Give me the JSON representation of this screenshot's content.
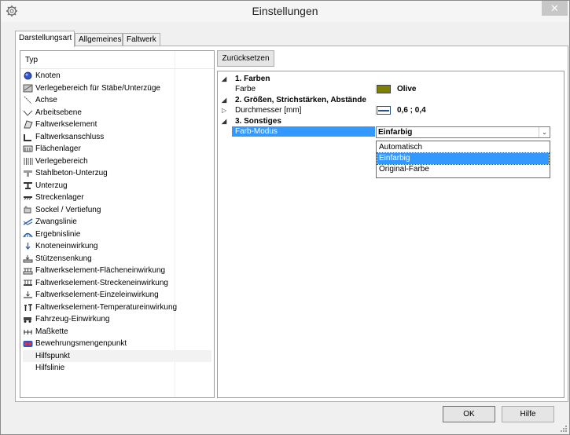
{
  "window": {
    "title": "Einstellungen",
    "close_glyph": "✕"
  },
  "tabs": [
    {
      "label": "Darstellungsart",
      "active": true
    },
    {
      "label": "Allgemeines",
      "active": false
    },
    {
      "label": "Faltwerk",
      "active": false
    }
  ],
  "typelist": {
    "header": "Typ",
    "items": [
      {
        "label": "Knoten",
        "icon": "node-icon"
      },
      {
        "label": "Verlegebereich für Stäbe/Unterzüge",
        "icon": "placement-area-icon"
      },
      {
        "label": "Achse",
        "icon": "axis-icon"
      },
      {
        "label": "Arbeitsebene",
        "icon": "work-plane-icon"
      },
      {
        "label": "Faltwerkselement",
        "icon": "folded-plate-element-icon"
      },
      {
        "label": "Faltwerksanschluss",
        "icon": "folded-plate-connection-icon"
      },
      {
        "label": "Flächenlager",
        "icon": "area-support-icon"
      },
      {
        "label": "Verlegebereich",
        "icon": "placement-region-icon"
      },
      {
        "label": "Stahlbeton-Unterzug",
        "icon": "concrete-beam-icon"
      },
      {
        "label": "Unterzug",
        "icon": "beam-icon"
      },
      {
        "label": "Streckenlager",
        "icon": "line-support-icon"
      },
      {
        "label": "Sockel / Vertiefung",
        "icon": "pedestal-icon"
      },
      {
        "label": "Zwangslinie",
        "icon": "constraint-line-icon"
      },
      {
        "label": "Ergebnislinie",
        "icon": "result-line-icon"
      },
      {
        "label": "Knoteneinwirkung",
        "icon": "node-load-icon"
      },
      {
        "label": "Stützensenkung",
        "icon": "column-settlement-icon"
      },
      {
        "label": "Faltwerkselement-Flächeneinwirkung",
        "icon": "area-load-icon"
      },
      {
        "label": "Faltwerkselement-Streckeneinwirkung",
        "icon": "line-load-icon"
      },
      {
        "label": "Faltwerkselement-Einzeleinwirkung",
        "icon": "point-load-icon"
      },
      {
        "label": "Faltwerkselement-Temperatureinwirkung",
        "icon": "temperature-load-icon"
      },
      {
        "label": "Fahrzeug-Einwirkung",
        "icon": "vehicle-load-icon"
      },
      {
        "label": "Maßkette",
        "icon": "dimension-chain-icon"
      },
      {
        "label": "Bewehrungsmengenpunkt",
        "icon": "reinforcement-point-icon"
      },
      {
        "label": "Hilfspunkt",
        "icon": ""
      },
      {
        "label": "Hilfslinie",
        "icon": ""
      }
    ],
    "hovered_item": "Hilfspunkt"
  },
  "reset_button": "Zurücksetzen",
  "propgrid": {
    "categories": [
      {
        "label": "1. Farben",
        "expander": "◢"
      },
      {
        "label": "2. Größen, Strichstärken, Abstände",
        "expander": "◢"
      },
      {
        "label": "3. Sonstiges",
        "expander": "◢"
      }
    ],
    "farbe": {
      "name": "Farbe",
      "value": "Olive",
      "swatch_color": "#808000"
    },
    "durchmesser": {
      "name": "Durchmesser [mm]",
      "value": "0,6 ; 0,4",
      "expander": "▷"
    },
    "farbmodus": {
      "name": "Farb-Modus",
      "value": "Einfarbig",
      "arrow": "⌄"
    },
    "dropdown_options": [
      {
        "label": "Automatisch",
        "selected": false
      },
      {
        "label": "Einfarbig",
        "selected": true
      },
      {
        "label": "Original-Farbe",
        "selected": false
      }
    ]
  },
  "footer": {
    "ok": "OK",
    "help": "Hilfe"
  }
}
